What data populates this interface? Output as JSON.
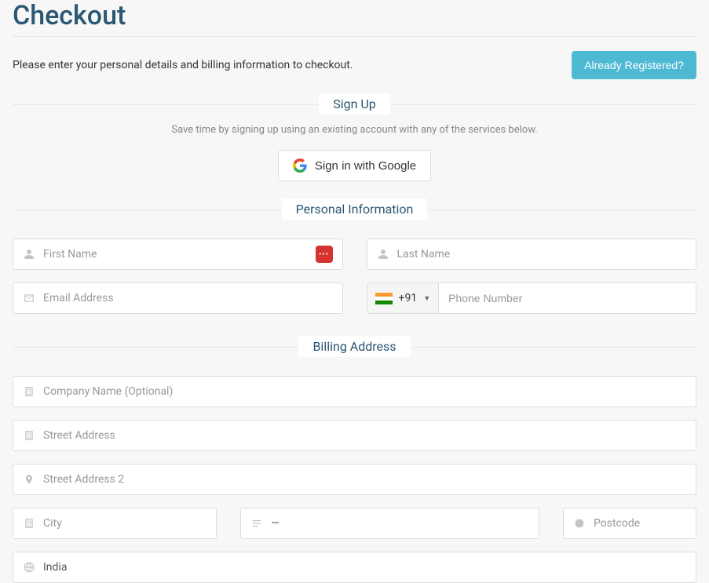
{
  "page": {
    "title": "Checkout",
    "subtitle": "Please enter your personal details and billing information to checkout.",
    "already_registered": "Already Registered?"
  },
  "signup": {
    "heading": "Sign Up",
    "help": "Save time by signing up using an existing account with any of the services below.",
    "google_label": "Sign in with Google"
  },
  "personal": {
    "heading": "Personal Information",
    "first_name_placeholder": "First Name",
    "last_name_placeholder": "Last Name",
    "email_placeholder": "Email Address",
    "phone_code": "+91",
    "phone_placeholder": "Phone Number"
  },
  "billing": {
    "heading": "Billing Address",
    "company_placeholder": "Company Name (Optional)",
    "street1_placeholder": "Street Address",
    "street2_placeholder": "Street Address 2",
    "city_placeholder": "City",
    "state_value": "—",
    "postcode_placeholder": "Postcode",
    "country_value": "India"
  }
}
